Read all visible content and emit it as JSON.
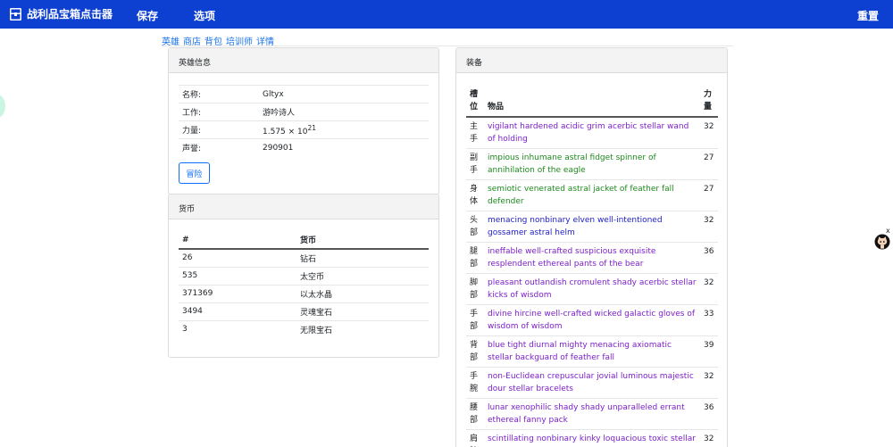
{
  "navbar": {
    "brand_icon": "treasure-chest-icon",
    "brand_label": "战利品宝箱点击器",
    "save_label": "保存",
    "options_label": "选项",
    "reset_label": "重置",
    "bg_color": "#0d3fd0"
  },
  "subnav": {
    "items": [
      "英雄",
      "商店",
      "背包",
      "培训师",
      "详情"
    ],
    "link_color": "#1a73e8"
  },
  "hero": {
    "header": "英雄信息",
    "rows": [
      {
        "key": "名称:",
        "value": "Gltyx"
      },
      {
        "key": "工作:",
        "value": "游吟诗人"
      },
      {
        "key": "力量:",
        "value_base": "1.575 × 10",
        "value_exp": "21"
      },
      {
        "key": "声誉:",
        "value": "290901"
      }
    ],
    "adventure_label": "冒险"
  },
  "currency": {
    "header": "货币",
    "col_count": "#",
    "col_name": "货币",
    "rows": [
      {
        "count": "26",
        "name": "钻石"
      },
      {
        "count": "535",
        "name": "太空币"
      },
      {
        "count": "371369",
        "name": "以太水晶"
      },
      {
        "count": "3494",
        "name": "灵魂宝石"
      },
      {
        "count": "3",
        "name": "无限宝石"
      }
    ]
  },
  "equipment": {
    "header": "装备",
    "col_slot": "槽位",
    "col_item": "物品",
    "col_str": "力量",
    "quality_colors": {
      "epic": "#7c1fc9",
      "uncommon": "#1d8a1d",
      "rare": "#1c1cc9"
    },
    "rows": [
      {
        "slot": "主手",
        "item": "vigilant hardened acidic grim acerbic stellar wand of holding",
        "str": "32",
        "quality": "epic"
      },
      {
        "slot": "副手",
        "item": "impious inhumane astral fidget spinner of annihilation of the eagle",
        "str": "27",
        "quality": "uncommon"
      },
      {
        "slot": "身体",
        "item": "semiotic venerated astral jacket of feather fall defender",
        "str": "27",
        "quality": "uncommon"
      },
      {
        "slot": "头部",
        "item": "menacing nonbinary elven well-intentioned gossamer astral helm",
        "str": "32",
        "quality": "rare"
      },
      {
        "slot": "腿部",
        "item": "ineffable well-crafted suspicious exquisite resplendent ethereal pants of the bear",
        "str": "36",
        "quality": "epic"
      },
      {
        "slot": "脚部",
        "item": "pleasant outlandish cromulent shady acerbic stellar kicks of wisdom",
        "str": "32",
        "quality": "epic"
      },
      {
        "slot": "手部",
        "item": "divine hircine well-crafted wicked galactic gloves of wisdom of wisdom",
        "str": "33",
        "quality": "epic"
      },
      {
        "slot": "背部",
        "item": "blue tight diurnal mighty menacing axiomatic stellar backguard of feather fall",
        "str": "39",
        "quality": "epic"
      },
      {
        "slot": "手腕",
        "item": "non-Euclidean crepuscular jovial luminous majestic dour stellar bracelets",
        "str": "32",
        "quality": "epic"
      },
      {
        "slot": "腰部",
        "item": "lunar xenophilic shady shady unparalleled errant ethereal fanny pack",
        "str": "36",
        "quality": "epic"
      },
      {
        "slot": "肩膀",
        "item": "scintillating nonbinary kinky loquacious toxic stellar pauldrons of the eagle",
        "str": "32",
        "quality": "epic"
      }
    ]
  },
  "side_widget": {
    "close_label": "x",
    "avatar_icon": "github-octocat-icon"
  }
}
